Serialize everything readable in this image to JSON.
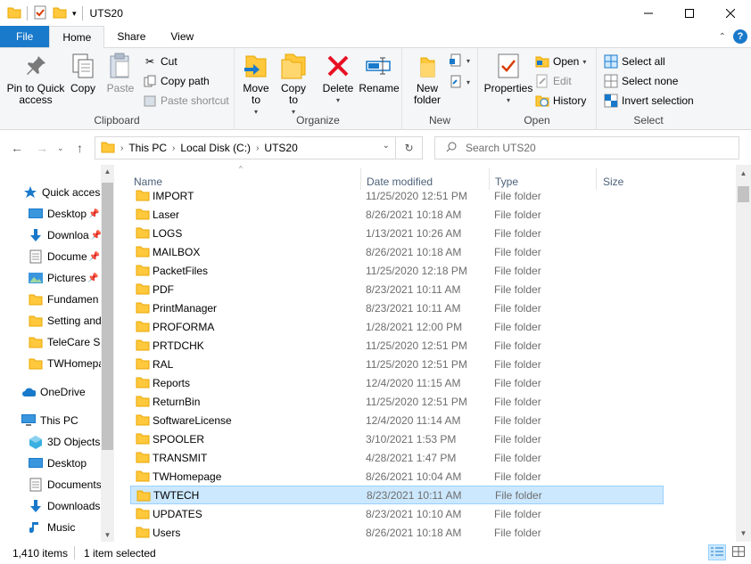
{
  "window": {
    "title": "UTS20"
  },
  "tabs": [
    {
      "label": "File"
    },
    {
      "label": "Home"
    },
    {
      "label": "Share"
    },
    {
      "label": "View"
    }
  ],
  "ribbon": {
    "clipboard": {
      "label": "Clipboard",
      "pin": "Pin to Quick access",
      "copy": "Copy",
      "paste": "Paste",
      "cut": "Cut",
      "copy_path": "Copy path",
      "paste_shortcut": "Paste shortcut"
    },
    "organize": {
      "label": "Organize",
      "move_to": "Move to",
      "copy_to": "Copy to",
      "delete": "Delete",
      "rename": "Rename"
    },
    "new": {
      "label": "New",
      "new_folder": "New folder"
    },
    "open": {
      "label": "Open",
      "properties": "Properties",
      "open": "Open",
      "edit": "Edit",
      "history": "History"
    },
    "select": {
      "label": "Select",
      "select_all": "Select all",
      "select_none": "Select none",
      "invert": "Invert selection"
    }
  },
  "address": {
    "crumbs": [
      "This PC",
      "Local Disk (C:)",
      "UTS20"
    ],
    "search_placeholder": "Search UTS20"
  },
  "navpane": {
    "quick_access": "Quick access",
    "items": [
      {
        "label": "Desktop",
        "icon": "desktop-icon",
        "pinned": true
      },
      {
        "label": "Downloa",
        "icon": "download-icon",
        "pinned": true
      },
      {
        "label": "Docume",
        "icon": "document-icon",
        "pinned": true
      },
      {
        "label": "Pictures",
        "icon": "pictures-icon",
        "pinned": true
      },
      {
        "label": "Fundamen",
        "icon": "folder-icon",
        "pinned": false
      },
      {
        "label": "Setting and",
        "icon": "folder-icon",
        "pinned": false
      },
      {
        "label": "TeleCare Se",
        "icon": "folder-icon",
        "pinned": false
      },
      {
        "label": "TWHomepa",
        "icon": "folder-icon",
        "pinned": false
      }
    ],
    "onedrive": "OneDrive",
    "this_pc": "This PC",
    "pc_items": [
      {
        "label": "3D Objects",
        "icon": "3d-objects-icon"
      },
      {
        "label": "Desktop",
        "icon": "desktop-icon"
      },
      {
        "label": "Documents",
        "icon": "document-icon"
      },
      {
        "label": "Downloads",
        "icon": "download-icon"
      },
      {
        "label": "Music",
        "icon": "music-icon"
      }
    ]
  },
  "columns": {
    "name": "Name",
    "date": "Date modified",
    "type": "Type",
    "size": "Size"
  },
  "files": [
    {
      "name": "IMPORT",
      "date": "11/25/2020 12:51 PM",
      "type": "File folder"
    },
    {
      "name": "Laser",
      "date": "8/26/2021 10:18 AM",
      "type": "File folder"
    },
    {
      "name": "LOGS",
      "date": "1/13/2021 10:26 AM",
      "type": "File folder"
    },
    {
      "name": "MAILBOX",
      "date": "8/26/2021 10:18 AM",
      "type": "File folder"
    },
    {
      "name": "PacketFiles",
      "date": "11/25/2020 12:18 PM",
      "type": "File folder"
    },
    {
      "name": "PDF",
      "date": "8/23/2021 10:11 AM",
      "type": "File folder"
    },
    {
      "name": "PrintManager",
      "date": "8/23/2021 10:11 AM",
      "type": "File folder"
    },
    {
      "name": "PROFORMA",
      "date": "1/28/2021 12:00 PM",
      "type": "File folder"
    },
    {
      "name": "PRTDCHK",
      "date": "11/25/2020 12:51 PM",
      "type": "File folder"
    },
    {
      "name": "RAL",
      "date": "11/25/2020 12:51 PM",
      "type": "File folder"
    },
    {
      "name": "Reports",
      "date": "12/4/2020 11:15 AM",
      "type": "File folder"
    },
    {
      "name": "ReturnBin",
      "date": "11/25/2020 12:51 PM",
      "type": "File folder"
    },
    {
      "name": "SoftwareLicense",
      "date": "12/4/2020 11:14 AM",
      "type": "File folder"
    },
    {
      "name": "SPOOLER",
      "date": "3/10/2021 1:53 PM",
      "type": "File folder"
    },
    {
      "name": "TRANSMIT",
      "date": "4/28/2021 1:47 PM",
      "type": "File folder"
    },
    {
      "name": "TWHomepage",
      "date": "8/26/2021 10:04 AM",
      "type": "File folder"
    },
    {
      "name": "TWTECH",
      "date": "8/23/2021 10:11 AM",
      "type": "File folder",
      "selected": true
    },
    {
      "name": "UPDATES",
      "date": "8/23/2021 10:10 AM",
      "type": "File folder"
    },
    {
      "name": "Users",
      "date": "8/26/2021 10:18 AM",
      "type": "File folder"
    }
  ],
  "status": {
    "count": "1,410 items",
    "selected": "1 item selected"
  },
  "colors": {
    "accent": "#1979ca",
    "folder": "#ffc83d",
    "folder_dark": "#e8a700",
    "selection": "#cce8ff"
  }
}
